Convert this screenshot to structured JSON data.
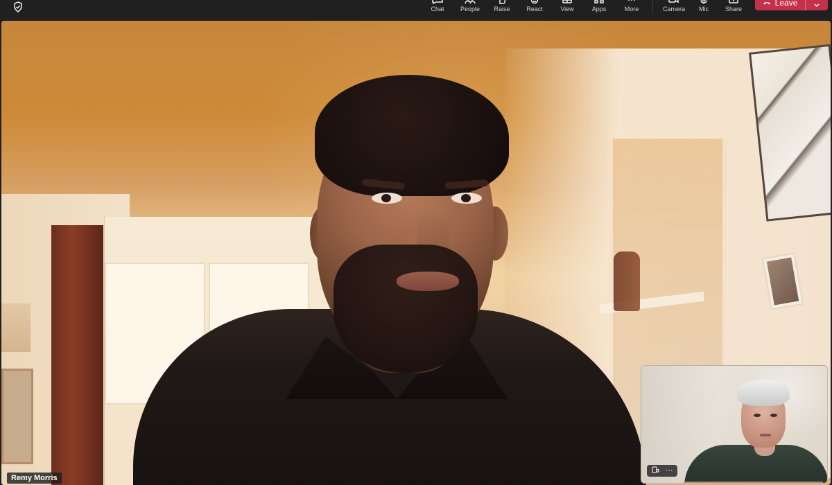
{
  "toolbar": {
    "items": [
      {
        "label": "Chat",
        "icon": "chat-icon"
      },
      {
        "label": "People",
        "icon": "people-icon"
      },
      {
        "label": "Raise",
        "icon": "hand-icon"
      },
      {
        "label": "React",
        "icon": "smile-icon"
      },
      {
        "label": "View",
        "icon": "view-icon"
      },
      {
        "label": "Apps",
        "icon": "apps-icon"
      },
      {
        "label": "More",
        "icon": "more-icon"
      },
      {
        "label": "Camera",
        "icon": "camera-icon"
      },
      {
        "label": "Mic",
        "icon": "mic-icon"
      },
      {
        "label": "Share",
        "icon": "share-icon"
      }
    ],
    "leave_label": "Leave",
    "leave_color": "#c4314b",
    "shield_icon": "shield-icon"
  },
  "main_video": {
    "participant_name": "Remy Morris"
  },
  "self_view": {
    "controls": [
      {
        "icon": "layout-icon"
      },
      {
        "icon": "more-icon",
        "label": "···"
      }
    ]
  }
}
